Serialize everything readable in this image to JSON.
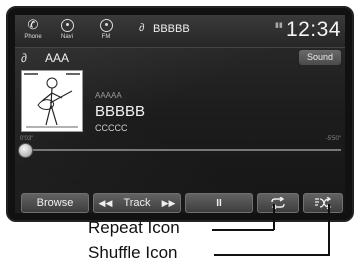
{
  "topbar": {
    "phone_label": "Phone",
    "navi_label": "Navi",
    "fm_label": "FM",
    "source_name": "BBBBB",
    "clock": "12:34"
  },
  "source_row": {
    "album_title": "AAA",
    "sound_label": "Sound"
  },
  "now_playing": {
    "artist": "AAAAA",
    "title": "BBBBB",
    "album": "CCCCC",
    "elapsed": "0'03\"",
    "remaining": "-5'50\"",
    "progress_fraction": 0.01
  },
  "controls": {
    "browse_label": "Browse",
    "track_label": "Track",
    "pause_symbol": "II"
  },
  "callouts": {
    "repeat": "Repeat Icon",
    "shuffle": "Shuffle Icon"
  }
}
